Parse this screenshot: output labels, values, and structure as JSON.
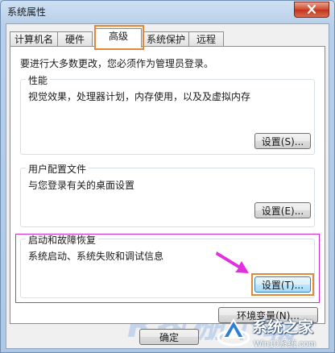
{
  "window": {
    "title": "系统属性",
    "close_icon": "close-icon"
  },
  "tabs": [
    {
      "label": "计算机名",
      "active": false
    },
    {
      "label": "硬件",
      "active": false
    },
    {
      "label": "高级",
      "active": true
    },
    {
      "label": "系统保护",
      "active": false
    },
    {
      "label": "远程",
      "active": false
    }
  ],
  "advanced": {
    "admin_note": "要进行大多数更改，您必须作为管理员登录。",
    "performance": {
      "title": "性能",
      "description": "视觉效果，处理器计划，内存使用，以及及虚拟内存",
      "button": "设置(S)..."
    },
    "user_profiles": {
      "title": "用户配置文件",
      "description": "与您登录有关的桌面设置",
      "button": "设置(E)..."
    },
    "startup": {
      "title": "启动和故障恢复",
      "description": "系统启动、系统失败和调试信息",
      "button": "设置(T)..."
    },
    "env_button": "环境变量(N)..."
  },
  "footer": {
    "ok_button": "确定"
  },
  "watermark": {
    "text": "R执棚下载",
    "brand_name": "系统之家",
    "brand_url": "Win10系统.com"
  },
  "colors": {
    "highlight_orange": "#e08a38",
    "highlight_magenta": "#d22bd0",
    "window_blue": "#b9d1ea"
  }
}
